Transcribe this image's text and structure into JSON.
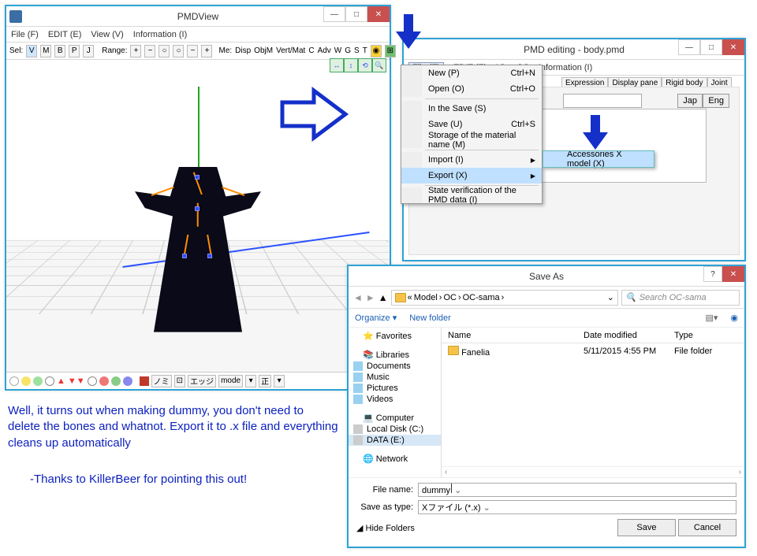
{
  "pmdview": {
    "title": "PMDView",
    "menus": [
      "File (F)",
      "EDIT (E)",
      "View (V)",
      "Information (I)"
    ],
    "tb_sel": "Sel:",
    "tb_btns1": [
      "V",
      "M",
      "B",
      "P",
      "J"
    ],
    "tb_range": "Range:",
    "tb_dirs": [
      "+",
      "−",
      "○",
      "○",
      "−",
      "+"
    ],
    "tb_labels": [
      "Me:",
      "Disp",
      "ObjM",
      "Vert/Mat",
      "C",
      "Adv",
      "W",
      "G",
      "S",
      "T"
    ],
    "bottombar": {
      "nomi": "ノミ",
      "ej": "エッジ",
      "mode": "mode",
      "sei": "正"
    }
  },
  "pmdedit": {
    "title": "PMD editing - body.pmd",
    "menus": [
      "File (F)",
      "EDIT (E)",
      "View (V)",
      "Information (I)"
    ],
    "tabs": [
      "Expression",
      "Display pane",
      "Rigid body",
      "Joint"
    ],
    "jap_btn": "Jap",
    "eng_btn": "Eng"
  },
  "filemenu": {
    "items": [
      {
        "label": "New (P)",
        "accel": "Ctrl+N"
      },
      {
        "label": "Open (O)",
        "accel": "Ctrl+O"
      },
      {
        "sep": true
      },
      {
        "label": "In the Save (S)",
        "accel": ""
      },
      {
        "label": "Save (U)",
        "accel": "Ctrl+S"
      },
      {
        "label": "Storage of the material name (M)",
        "accel": ""
      },
      {
        "sep": true
      },
      {
        "label": "Import (I)",
        "accel": "",
        "sub": true
      },
      {
        "label": "Export (X)",
        "accel": "",
        "sub": true,
        "hi": true
      },
      {
        "sep": true
      },
      {
        "label": "State verification of the PMD data (I)",
        "accel": ""
      }
    ],
    "submenu_item": "Accessories X model (X)"
  },
  "saveas": {
    "title": "Save As",
    "crumbs": [
      "Model",
      "OC",
      "OC-sama"
    ],
    "search_placeholder": "Search OC-sama",
    "organize": "Organize ▾",
    "newfolder": "New folder",
    "nav": {
      "favorites": "Favorites",
      "libraries": "Libraries",
      "libs": [
        "Documents",
        "Music",
        "Pictures",
        "Videos"
      ],
      "computer": "Computer",
      "drives": [
        "Local Disk (C:)",
        "DATA (E:)"
      ],
      "network": "Network"
    },
    "cols": {
      "name": "Name",
      "date": "Date modified",
      "type": "Type"
    },
    "rows": [
      {
        "name": "Fanelia",
        "date": "5/11/2015 4:55 PM",
        "type": "File folder"
      }
    ],
    "filename_label": "File name:",
    "filename_value": "dummy",
    "saveastype_label": "Save as type:",
    "saveastype_value": "Xファイル (*.x)",
    "hide": "Hide Folders",
    "save_btn": "Save",
    "cancel_btn": "Cancel"
  },
  "caption": {
    "body": "Well, it turns out when making dummy, you don't need to delete the bones and whatnot. Export it to .x file and everything cleans up automatically",
    "thanks": "-Thanks to KillerBeer for pointing this out!"
  }
}
